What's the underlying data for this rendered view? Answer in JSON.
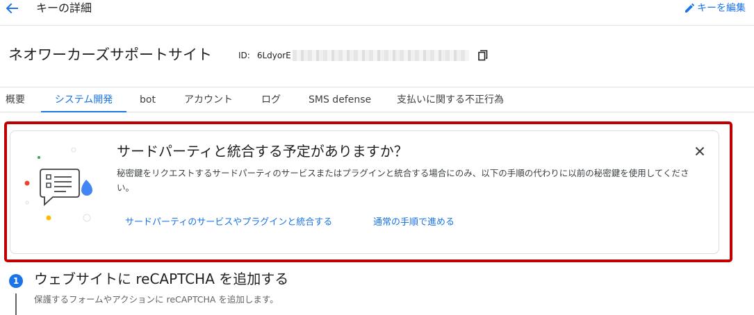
{
  "topbar": {
    "title": "キーの詳細",
    "back_icon": "arrow-back-icon",
    "edit_icon": "pencil-icon",
    "edit_label": "キーを編集"
  },
  "key": {
    "name": "ネオワーカーズサポートサイト",
    "id_label": "ID:",
    "id_value": "6LdyorE",
    "copy_icon": "copy-icon"
  },
  "tabs": [
    {
      "label": "概要",
      "active": false
    },
    {
      "label": "システム開発",
      "active": true
    },
    {
      "label": "bot",
      "active": false
    },
    {
      "label": "アカウント",
      "active": false
    },
    {
      "label": "ログ",
      "active": false
    },
    {
      "label": "SMS defense",
      "active": false
    },
    {
      "label": "支払いに関する不正行為",
      "active": false
    }
  ],
  "banner": {
    "title": "サードパーティと統合する予定がありますか？",
    "body": "秘密鍵をリクエストするサードパーティのサービスまたはプラグインと統合する場合にのみ、以下の手順の代わりに以前の秘密鍵を使用してください。",
    "close_icon": "close-icon",
    "link_integrate": "サードパーティのサービスやプラグインと統合する",
    "link_normal": "通常の手順で進める",
    "highlight_color": "#c00000"
  },
  "step": {
    "number": "1",
    "title": "ウェブサイトに reCAPTCHA を追加する",
    "description": "保護するフォームやアクションに reCAPTCHA を追加します。"
  },
  "colors": {
    "accent": "#1a73e8",
    "text": "#202124",
    "border": "#dadce0"
  }
}
